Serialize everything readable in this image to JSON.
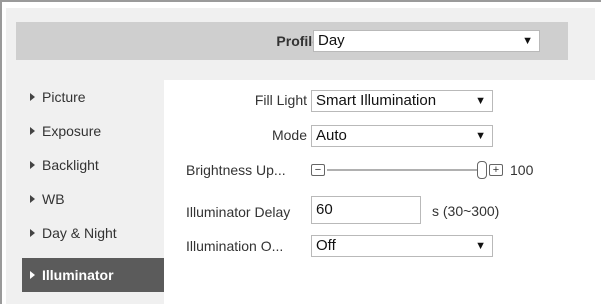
{
  "profile": {
    "label": "Profile",
    "value": "Day"
  },
  "sidebar": {
    "items": [
      {
        "label": "Picture"
      },
      {
        "label": "Exposure"
      },
      {
        "label": "Backlight"
      },
      {
        "label": "WB"
      },
      {
        "label": "Day & Night"
      },
      {
        "label": "Illuminator",
        "active": true
      }
    ]
  },
  "form": {
    "fill_light": {
      "label": "Fill Light",
      "value": "Smart Illumination"
    },
    "mode": {
      "label": "Mode",
      "value": "Auto"
    },
    "brightness": {
      "label": "Brightness Up...",
      "value": "100",
      "level_fraction": 1.0,
      "minus": "−",
      "plus": "+"
    },
    "illuminator_delay": {
      "label": "Illuminator Delay",
      "value": "60",
      "unit": "s (30~300)"
    },
    "illumination_o": {
      "label": "Illumination O...",
      "value": "Off"
    }
  },
  "icons": {
    "dropdown": "dropdown-arrow-icon",
    "bullet": "triangle-right-icon"
  },
  "colors": {
    "active_bg": "#5b5b5b",
    "header_bg": "#cfcfcf",
    "panel_bg": "#f0f0f0"
  }
}
